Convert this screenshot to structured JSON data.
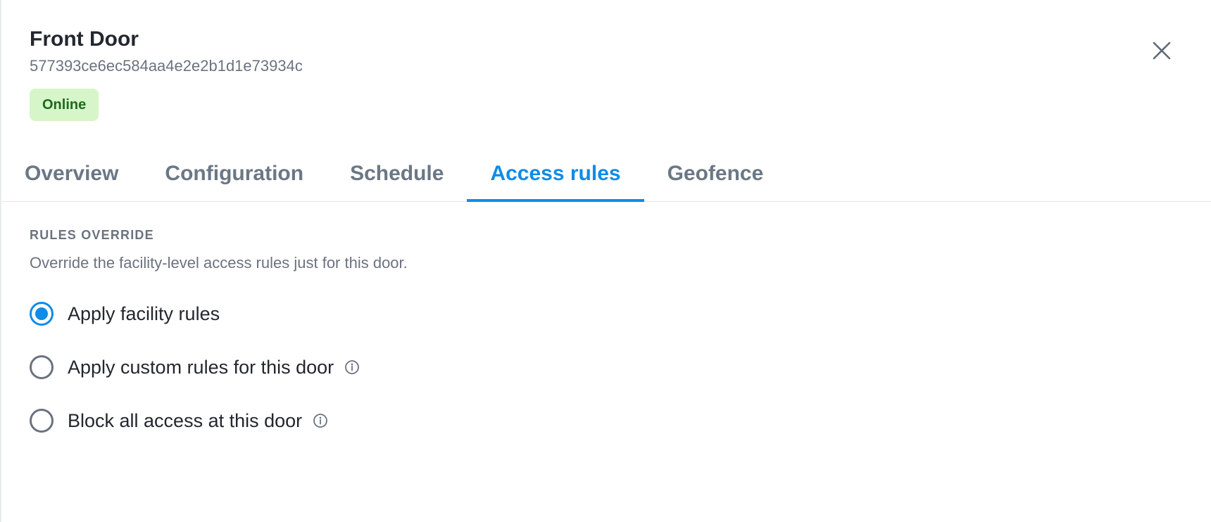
{
  "header": {
    "title": "Front Door",
    "device_id": "577393ce6ec584aa4e2e2b1d1e73934c",
    "status": "Online"
  },
  "close_icon": "close-icon",
  "tabs": [
    {
      "label": "Overview",
      "active": false
    },
    {
      "label": "Configuration",
      "active": false
    },
    {
      "label": "Schedule",
      "active": false
    },
    {
      "label": "Access rules",
      "active": true
    },
    {
      "label": "Geofence",
      "active": false
    }
  ],
  "rules": {
    "heading": "RULES OVERRIDE",
    "description": "Override the facility-level access rules just for this door.",
    "options": [
      {
        "label": "Apply facility rules",
        "checked": true,
        "info": false
      },
      {
        "label": "Apply custom rules for this door",
        "checked": false,
        "info": true
      },
      {
        "label": "Block all access at this door",
        "checked": false,
        "info": true
      }
    ]
  },
  "colors": {
    "accent": "#0d8ce8",
    "status_bg": "#d6f5c9",
    "status_text": "#1b6b1b"
  }
}
